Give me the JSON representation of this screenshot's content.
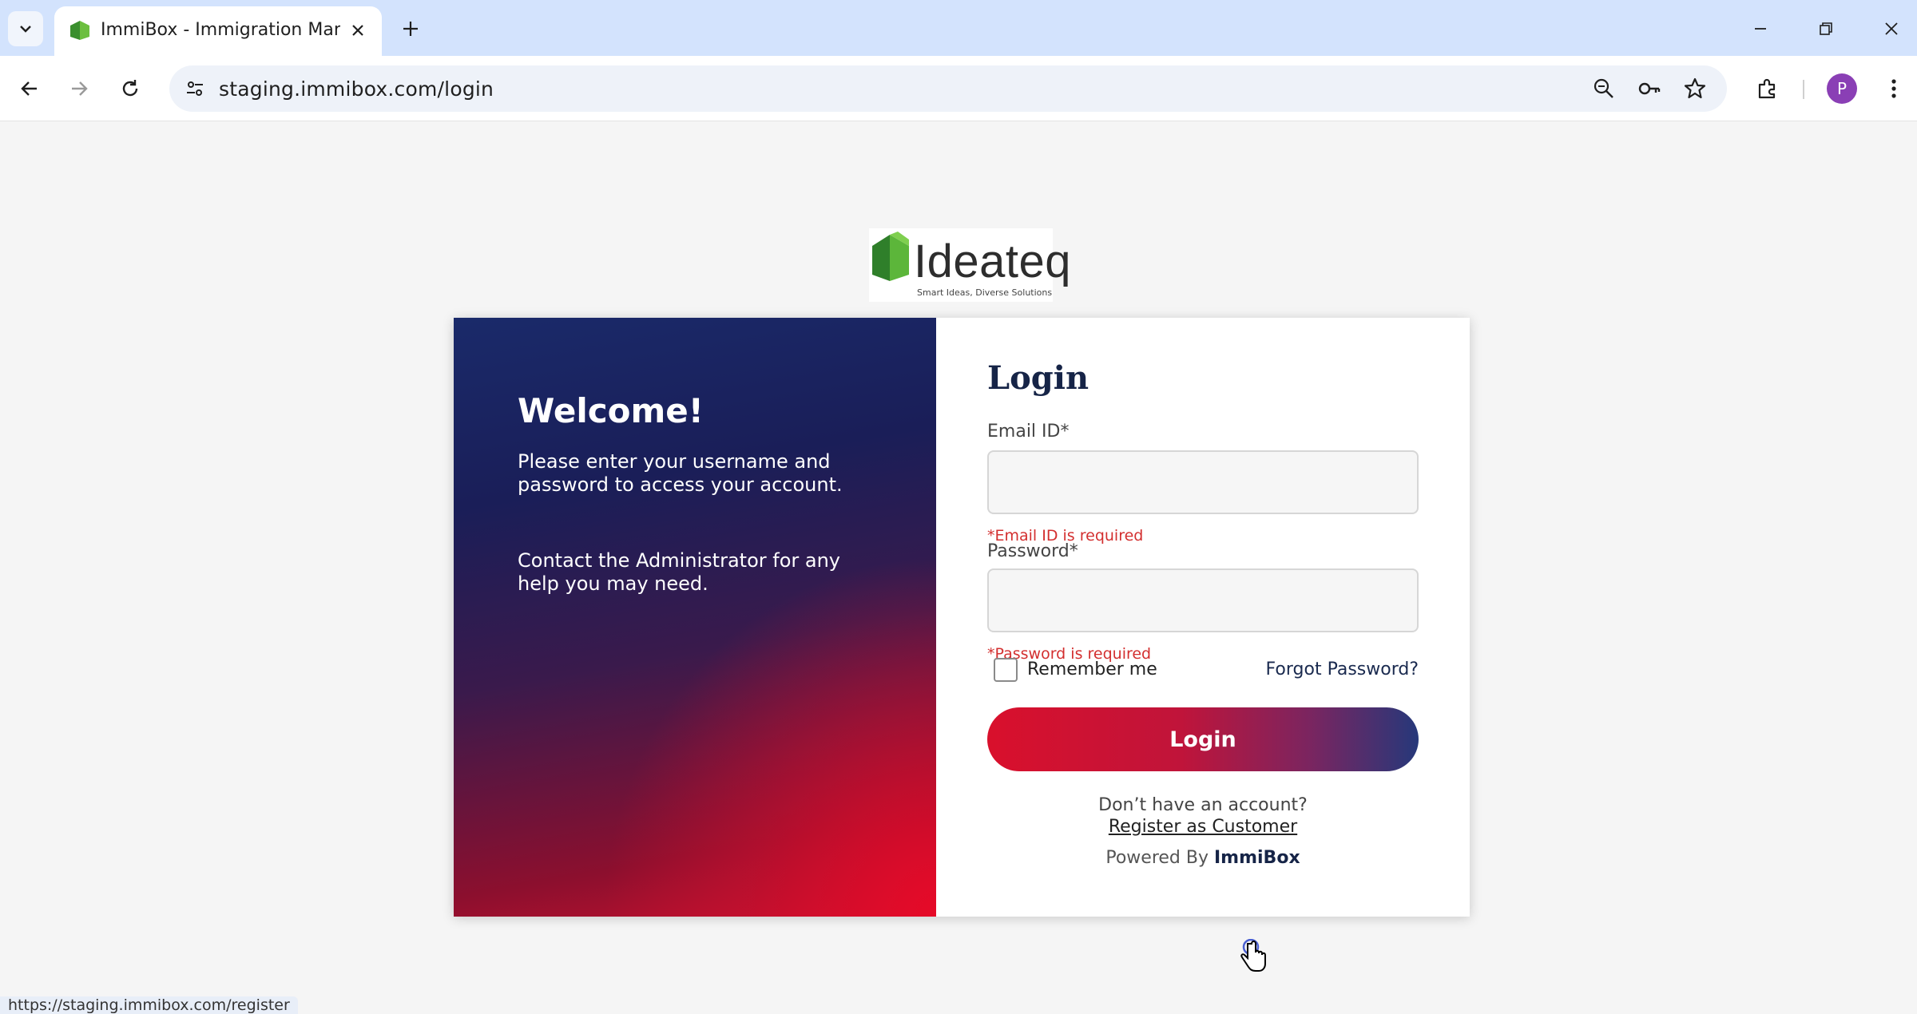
{
  "browser": {
    "tab": {
      "title": "ImmiBox - Immigration Manage",
      "favicon": "ideateq-logo-icon"
    },
    "url": "staging.immibox.com/login",
    "profile_initial": "P",
    "status_url": "https://staging.immibox.com/register"
  },
  "logo": {
    "brand": "Ideateq",
    "tagline": "Smart Ideas, Diverse Solutions"
  },
  "welcome": {
    "title": "Welcome!",
    "text": "Please enter your username and password to access your account.",
    "contact": "Contact the Administrator for any help you may need."
  },
  "login": {
    "title": "Login",
    "email_label": "Email ID*",
    "email_value": "",
    "email_error": "*Email ID is required",
    "password_label": "Password*",
    "password_value": "",
    "password_error": "*Password is required",
    "remember_label": "Remember me",
    "remember_checked": false,
    "forgot_label": "Forgot Password?",
    "submit_label": "Login",
    "no_account_text": "Don’t have an account?",
    "register_label": "Register as Customer",
    "powered_prefix": "Powered By",
    "powered_brand": "ImmiBox"
  },
  "colors": {
    "accent_red": "#d9102c",
    "accent_navy": "#26387a",
    "error": "#d32f2f",
    "title_navy": "#162447"
  }
}
